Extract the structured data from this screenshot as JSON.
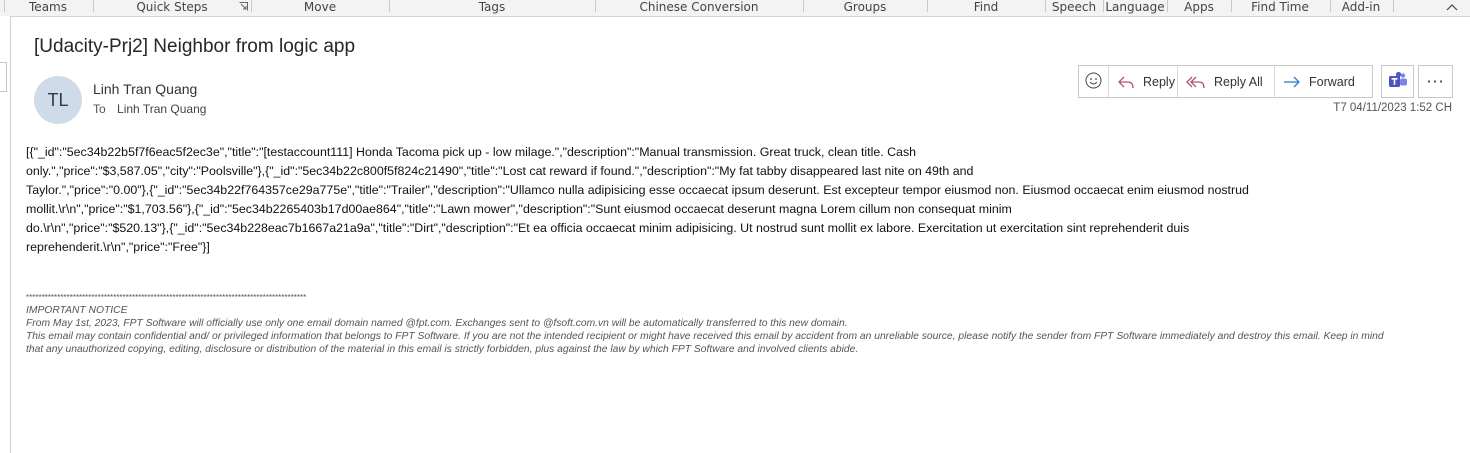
{
  "ribbon": {
    "groups": [
      "Teams",
      "Quick Steps",
      "Move",
      "Tags",
      "Chinese Conversion",
      "Groups",
      "Find",
      "Speech",
      "Language",
      "Apps",
      "Find Time",
      "Add-in"
    ]
  },
  "message": {
    "subject": "[Udacity-Prj2] Neighbor from logic app",
    "avatar_initials": "TL",
    "sender": "Linh Tran Quang",
    "to_label": "To",
    "to": "Linh Tran Quang",
    "timestamp": "T7 04/11/2023 1:52 CH"
  },
  "actions": {
    "reply": "Reply",
    "reply_all": "Reply All",
    "forward": "Forward",
    "more": "···"
  },
  "body": {
    "lines": [
      "[{\"_id\":\"5ec34b22b5f7f6eac5f2ec3e\",\"title\":\"[testaccount111] Honda Tacoma pick up - low milage.\",\"description\":\"Manual transmission. Great truck, clean title. Cash",
      "only.\",\"price\":\"$3,587.05\",\"city\":\"Poolsville\"},{\"_id\":\"5ec34b22c800f5f824c21490\",\"title\":\"Lost cat reward if found.\",\"description\":\"My fat tabby disappeared last nite on 49th and",
      "Taylor.\",\"price\":\"0.00\"},{\"_id\":\"5ec34b22f764357ce29a775e\",\"title\":\"Trailer\",\"description\":\"Ullamco nulla adipisicing esse occaecat ipsum deserunt. Est excepteur tempor eiusmod non. Eiusmod occaecat enim eiusmod nostrud",
      "mollit.\\r\\n\",\"price\":\"$1,703.56\"},{\"_id\":\"5ec34b2265403b17d00ae864\",\"title\":\"Lawn mower\",\"description\":\"Sunt eiusmod occaecat deserunt magna Lorem cillum non consequat minim",
      "do.\\r\\n\",\"price\":\"$520.13\"},{\"_id\":\"5ec34b228eac7b1667a21a9a\",\"title\":\"Dirt\",\"description\":\"Et ea officia occaecat minim adipisicing. Ut nostrud sunt mollit ex labore. Exercitation ut exercitation sint reprehenderit duis",
      "reprehenderit.\\r\\n\",\"price\":\"Free\"}]"
    ]
  },
  "notice": {
    "stars": "******************************************************************************************",
    "heading": "IMPORTANT NOTICE",
    "line1": "From May 1st, 2023, FPT Software will officially use only one email domain named @fpt.com. Exchanges sent to @fsoft.com.vn will be automatically transferred to this new domain.",
    "line2": "This email may contain confidential and/ or privileged information that belongs to FPT Software. If you are not the intended recipient or might have received this email by accident from an unreliable source, please notify the sender from FPT Software immediately and destroy this email. Keep in mind",
    "line3": "that any unauthorized copying, editing, disclosure or distribution of the material in this email is strictly forbidden, plus against the law by which FPT Software and involved clients abide."
  },
  "colors": {
    "accent": "#2b579a",
    "reply_arrow": "#b4566e",
    "forward_arrow": "#2b7cd3",
    "teams": "#5059c9",
    "avatar_bg": "#cfdbe9"
  }
}
